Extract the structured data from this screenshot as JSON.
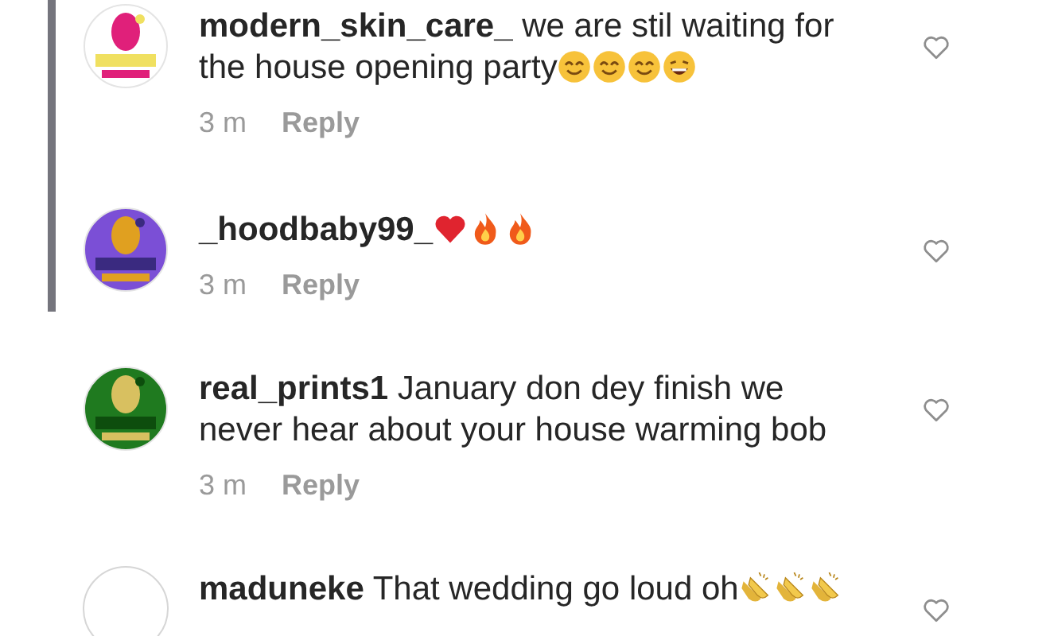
{
  "comments": [
    {
      "username": "modern_skin_care_",
      "text": "we are stil waiting for the house opening party",
      "emojis": [
        {
          "kind": "smile"
        },
        {
          "kind": "smile"
        },
        {
          "kind": "smile"
        },
        {
          "kind": "laugh"
        }
      ],
      "avatar": {
        "kind": "picture"
      },
      "in_thread": true,
      "time": "3 m",
      "reply": "Reply",
      "liked": false
    },
    {
      "username": "_hoodbaby99_",
      "emojis": [
        {
          "kind": "heart"
        },
        {
          "kind": "fire"
        },
        {
          "kind": "fire"
        }
      ],
      "avatar": {
        "kind": "picture"
      },
      "in_thread": true,
      "time": "3 m",
      "reply": "Reply",
      "liked": false
    },
    {
      "username": "real_prints1",
      "text": "January don dey finish we never hear about your house warming bob",
      "avatar": {
        "kind": "picture"
      },
      "in_thread": false,
      "time": "3 m",
      "reply": "Reply",
      "liked": false
    },
    {
      "username": "maduneke",
      "text": "That wedding go loud oh",
      "emojis": [
        {
          "kind": "clap"
        },
        {
          "kind": "clap"
        },
        {
          "kind": "clap"
        }
      ],
      "avatar": {
        "kind": "empty"
      },
      "in_thread": false,
      "liked": false
    }
  ]
}
